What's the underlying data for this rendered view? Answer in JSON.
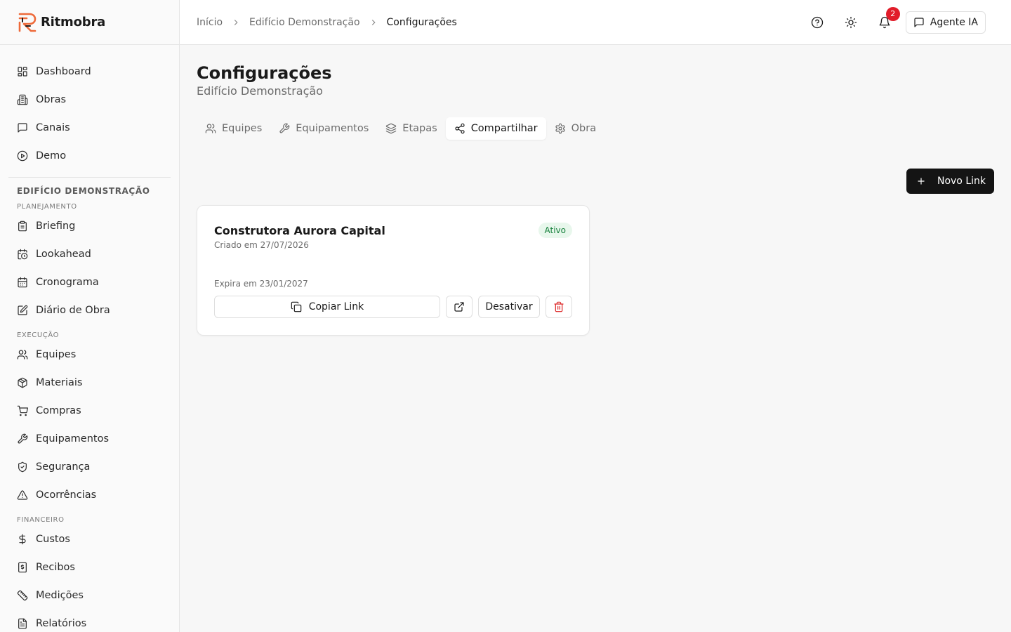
{
  "app": {
    "name": "Ritmobra"
  },
  "sidebar": {
    "main_items": [
      {
        "label": "Dashboard",
        "icon": "dashboard-icon"
      },
      {
        "label": "Obras",
        "icon": "building-icon"
      },
      {
        "label": "Canais",
        "icon": "message-icon"
      },
      {
        "label": "Demo",
        "icon": "play-icon"
      }
    ],
    "project_title": "Edifício Demonstração",
    "groups": [
      {
        "label": "Planejamento",
        "items": [
          {
            "label": "Briefing",
            "icon": "clipboard-icon"
          },
          {
            "label": "Lookahead",
            "icon": "calendar-clock-icon"
          },
          {
            "label": "Cronograma",
            "icon": "calendar-icon"
          },
          {
            "label": "Diário de Obra",
            "icon": "edit-icon"
          }
        ]
      },
      {
        "label": "Execução",
        "items": [
          {
            "label": "Equipes",
            "icon": "users-icon"
          },
          {
            "label": "Materiais",
            "icon": "package-icon"
          },
          {
            "label": "Compras",
            "icon": "cart-icon"
          },
          {
            "label": "Equipamentos",
            "icon": "wrench-icon"
          },
          {
            "label": "Segurança",
            "icon": "shield-icon"
          },
          {
            "label": "Ocorrências",
            "icon": "alert-icon"
          }
        ]
      },
      {
        "label": "Financeiro",
        "items": [
          {
            "label": "Custos",
            "icon": "dollar-icon"
          },
          {
            "label": "Recibos",
            "icon": "receipt-icon"
          },
          {
            "label": "Medições",
            "icon": "ruler-icon"
          },
          {
            "label": "Relatórios",
            "icon": "file-icon"
          }
        ]
      }
    ]
  },
  "header": {
    "breadcrumb": [
      "Início",
      "Edifício Demonstração",
      "Configurações"
    ],
    "notification_count": "2",
    "agent_label": "Agente IA"
  },
  "page": {
    "title": "Configurações",
    "subtitle": "Edifício Demonstração"
  },
  "tabs": [
    {
      "label": "Equipes",
      "active": false
    },
    {
      "label": "Equipamentos",
      "active": false
    },
    {
      "label": "Etapas",
      "active": false
    },
    {
      "label": "Compartilhar",
      "active": true
    },
    {
      "label": "Obra",
      "active": false
    }
  ],
  "new_link_label": "Novo Link",
  "share_card": {
    "name": "Construtora Aurora Capital",
    "created": "Criado em 27/07/2026",
    "status": "Ativo",
    "expires": "Expira em 23/01/2027",
    "copy_label": "Copiar Link",
    "deactivate_label": "Desativar"
  },
  "colors": {
    "accent": "#141414",
    "status_active_bg": "#e8f7ec",
    "status_active_text": "#16803c",
    "danger": "#dc2626",
    "badge": "#e11d2a"
  }
}
